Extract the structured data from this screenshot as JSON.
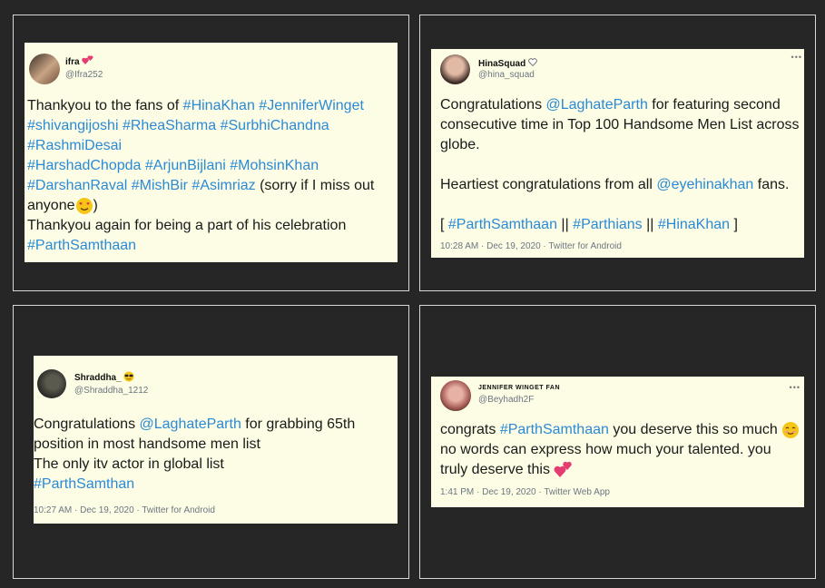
{
  "colors": {
    "background": "#262626",
    "card": "#fdfde5",
    "hashtag": "#2a8ad6",
    "meta": "#6b7680",
    "heart": "#e53d72",
    "emoji_face": "#f5c518"
  },
  "tweets": [
    {
      "name": "ifra",
      "name_icon": "two-hearts-icon",
      "handle": "@Ifra252",
      "lines": [
        [
          {
            "t": "Thankyou to the fans of "
          },
          {
            "t": "#HinaKhan",
            "tag": true
          },
          {
            "t": " "
          },
          {
            "t": "#JenniferWinget",
            "tag": true
          }
        ],
        [
          {
            "t": "#shivangijoshi",
            "tag": true
          },
          {
            "t": " "
          },
          {
            "t": "#RheaSharma",
            "tag": true
          },
          {
            "t": " "
          },
          {
            "t": "#SurbhiChandna",
            "tag": true
          }
        ],
        [
          {
            "t": "#RashmiDesai",
            "tag": true
          }
        ],
        [
          {
            "t": "#HarshadChopda",
            "tag": true
          },
          {
            "t": " "
          },
          {
            "t": "#ArjunBijlani",
            "tag": true
          },
          {
            "t": " "
          },
          {
            "t": "#MohsinKhan",
            "tag": true
          }
        ],
        [
          {
            "t": "#DarshanRaval",
            "tag": true
          },
          {
            "t": " "
          },
          {
            "t": "#MishBir",
            "tag": true
          },
          {
            "t": " "
          },
          {
            "t": "#Asimriaz",
            "tag": true
          },
          {
            "t": "  (sorry if I miss out"
          }
        ],
        [
          {
            "t": "anyone"
          },
          {
            "emoji": "smiling-face-hearts-icon"
          },
          {
            "t": ")"
          }
        ],
        [
          {
            "t": "Thankyou again for being a part of his celebration"
          }
        ],
        [
          {
            "t": "#ParthSamthaan",
            "tag": true
          }
        ]
      ],
      "meta": ""
    },
    {
      "name": "HinaSquad",
      "name_icon": "white-heart-icon",
      "handle": "@hina_squad",
      "lines": [
        [
          {
            "t": "Congratulations "
          },
          {
            "t": "@LaghateParth",
            "tag": true
          },
          {
            "t": " for featuring second"
          }
        ],
        [
          {
            "t": "consecutive time in Top 100 Handsome Men List across"
          }
        ],
        [
          {
            "t": "globe."
          }
        ],
        [
          {
            "t": ""
          }
        ],
        [
          {
            "t": "Heartiest congratulations from all "
          },
          {
            "t": "@eyehinakhan",
            "tag": true
          },
          {
            "t": " fans."
          }
        ],
        [
          {
            "t": ""
          }
        ],
        [
          {
            "t": "[ "
          },
          {
            "t": "#ParthSamthaan",
            "tag": true
          },
          {
            "t": " || "
          },
          {
            "t": "#Parthians",
            "tag": true
          },
          {
            "t": " || "
          },
          {
            "t": "#HinaKhan",
            "tag": true
          },
          {
            "t": " ]"
          }
        ]
      ],
      "meta": "10:28 AM · Dec 19, 2020 · Twitter for Android"
    },
    {
      "name": "Shraddha_",
      "name_icon": "sunglasses-face-icon",
      "handle": "@Shraddha_1212",
      "lines": [
        [
          {
            "t": "Congratulations "
          },
          {
            "t": "@LaghateParth",
            "tag": true
          },
          {
            "t": " for grabbing 65th"
          }
        ],
        [
          {
            "t": "position in most handsome men list"
          }
        ],
        [
          {
            "t": "The only itv actor in global list"
          }
        ],
        [
          {
            "t": "#ParthSamthan",
            "tag": true
          }
        ]
      ],
      "meta": "10:27 AM · Dec 19, 2020 · Twitter for Android"
    },
    {
      "name": "JENNIFER WINGET FAN",
      "name_icon": "",
      "handle": "@Beyhadh2F",
      "lines": [
        [
          {
            "t": "congrats "
          },
          {
            "t": "#ParthSamthaan",
            "tag": true
          },
          {
            "t": " you deserve this so much "
          },
          {
            "emoji": "smiling-face-icon"
          }
        ],
        [
          {
            "t": "no words can express how much your talented. you"
          }
        ],
        [
          {
            "t": "truly deserve this "
          },
          {
            "emoji": "two-hearts-icon"
          }
        ]
      ],
      "meta": "1:41 PM · Dec 19, 2020 · Twitter Web App"
    }
  ]
}
